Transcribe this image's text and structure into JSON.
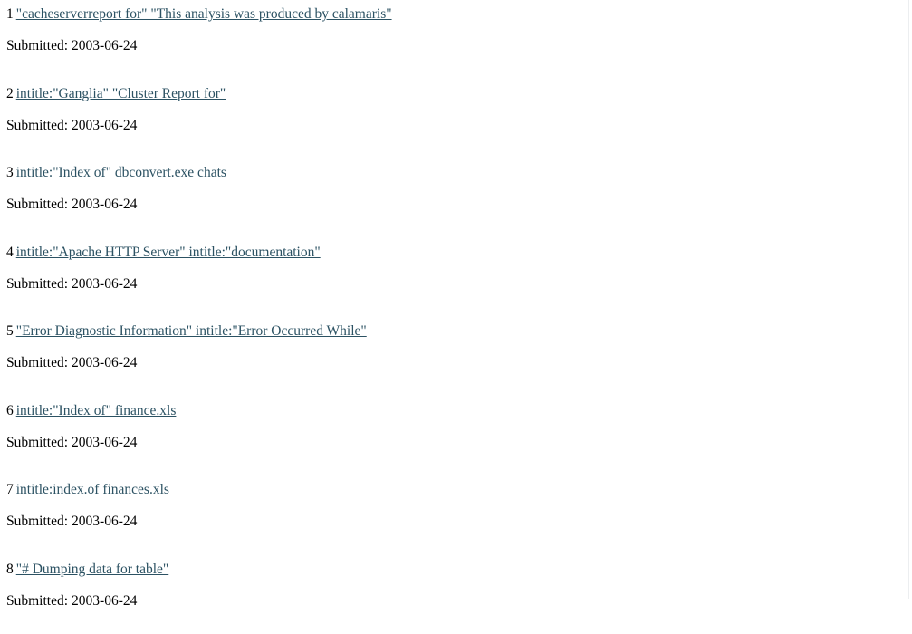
{
  "page": {
    "background_color": "#ffffff",
    "link_color": "#2c5263",
    "text_color": "#000000",
    "submitted_label": "Submitted:"
  },
  "entries": [
    {
      "index": "1",
      "query": "\"cacheserverreport for\" \"This analysis was produced by calamaris\"",
      "submitted_label": "Submitted:",
      "submitted_date": "2003-06-24"
    },
    {
      "index": "2",
      "query": "intitle:\"Ganglia\" \"Cluster Report for\"",
      "submitted_label": "Submitted:",
      "submitted_date": "2003-06-24"
    },
    {
      "index": "3",
      "query": "intitle:\"Index of\" dbconvert.exe chats",
      "submitted_label": "Submitted:",
      "submitted_date": "2003-06-24"
    },
    {
      "index": "4",
      "query": "intitle:\"Apache HTTP Server\" intitle:\"documentation\"",
      "submitted_label": "Submitted:",
      "submitted_date": "2003-06-24"
    },
    {
      "index": "5",
      "query": "\"Error Diagnostic Information\" intitle:\"Error Occurred While\"",
      "submitted_label": "Submitted:",
      "submitted_date": "2003-06-24"
    },
    {
      "index": "6",
      "query": "intitle:\"Index of\" finance.xls",
      "submitted_label": "Submitted:",
      "submitted_date": "2003-06-24"
    },
    {
      "index": "7",
      "query": "intitle:index.of finances.xls",
      "submitted_label": "Submitted:",
      "submitted_date": "2003-06-24"
    },
    {
      "index": "8",
      "query": "\"# Dumping data for table\"",
      "submitted_label": "Submitted:",
      "submitted_date": "2003-06-24"
    }
  ]
}
